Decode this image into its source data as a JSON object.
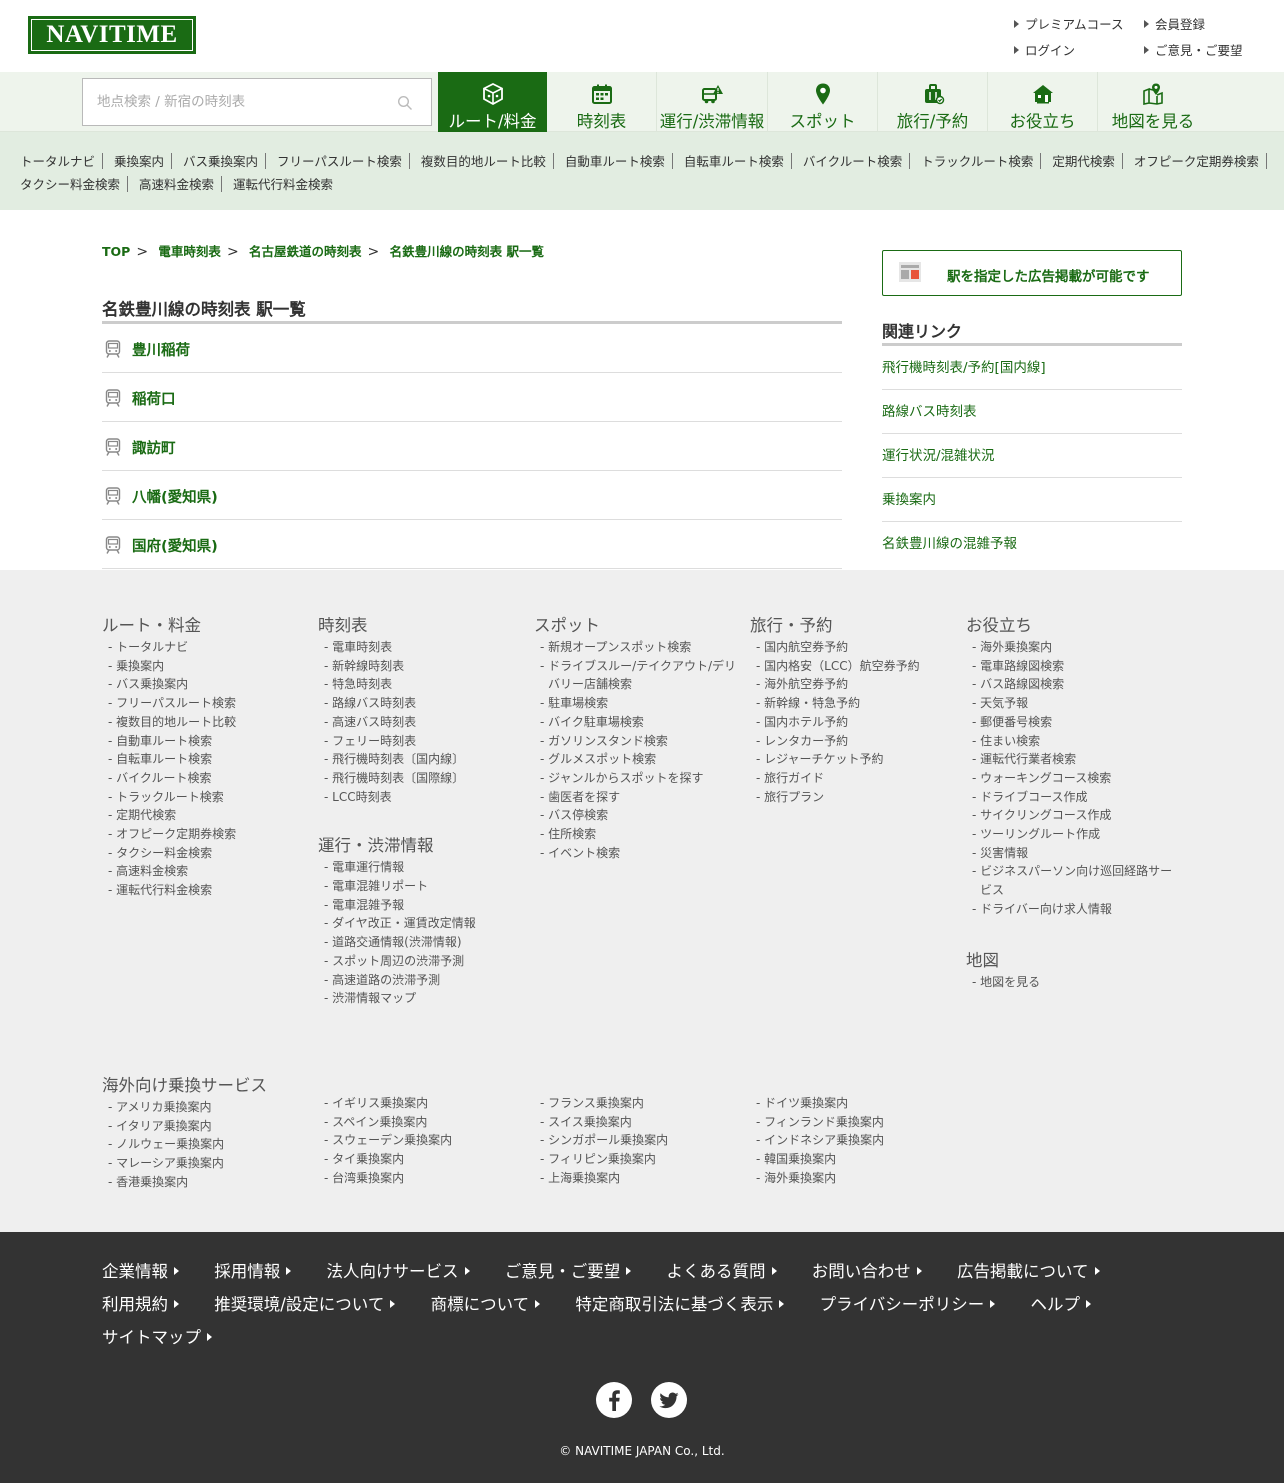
{
  "header": {
    "logo": "NAVITIME",
    "links": [
      "プレミアムコース",
      "会員登録",
      "ログイン",
      "ご意見・ご要望"
    ]
  },
  "search": {
    "placeholder": "地点検索 / 新宿の時刻表"
  },
  "nav": {
    "tabs": [
      {
        "label": "ルート/料金",
        "icon": "route-box-icon",
        "active": true
      },
      {
        "label": "時刻表",
        "icon": "calendar-icon"
      },
      {
        "label": "運行/渋滞情報",
        "icon": "traffic-info-icon"
      },
      {
        "label": "スポット",
        "icon": "map-pin-icon"
      },
      {
        "label": "旅行/予約",
        "icon": "suitcase-icon"
      },
      {
        "label": "お役立ち",
        "icon": "house-icon"
      },
      {
        "label": "地図を見る",
        "icon": "map-icon"
      }
    ]
  },
  "subnav": {
    "row1": [
      "トータルナビ",
      "乗換案内",
      "バス乗換案内",
      "フリーパスルート検索",
      "複数目的地ルート比較",
      "自動車ルート検索",
      "自転車ルート検索",
      "バイクルート検索",
      "トラックルート検索",
      "定期代検索",
      "オフピーク定期券検索"
    ],
    "row2": [
      "タクシー料金検索",
      "高速料金検索",
      "運転代行料金検索"
    ]
  },
  "breadcrumb": [
    "TOP",
    "電車時刻表",
    "名古屋鉄道の時刻表",
    "名鉄豊川線の時刻表 駅一覧"
  ],
  "breadcrumb_sep": ">",
  "main": {
    "title": "名鉄豊川線の時刻表 駅一覧",
    "stations": [
      "豊川稲荷",
      "稲荷口",
      "諏訪町",
      "八幡(愛知県)",
      "国府(愛知県)"
    ]
  },
  "sidebar": {
    "ad_text": "駅を指定した広告掲載が可能です",
    "related_title": "関連リンク",
    "related": [
      "飛行機時刻表/予約[国内線]",
      "路線バス時刻表",
      "運行状況/混雑状況",
      "乗換案内",
      "名鉄豊川線の混雑予報"
    ]
  },
  "sitemap": {
    "route": {
      "title": "ルート・料金",
      "items": [
        "トータルナビ",
        "乗換案内",
        "バス乗換案内",
        "フリーパスルート検索",
        "複数目的地ルート比較",
        "自動車ルート検索",
        "自転車ルート検索",
        "バイクルート検索",
        "トラックルート検索",
        "定期代検索",
        "オフピーク定期券検索",
        "タクシー料金検索",
        "高速料金検索",
        "運転代行料金検索"
      ]
    },
    "timetable": {
      "title": "時刻表",
      "items": [
        "電車時刻表",
        "新幹線時刻表",
        "特急時刻表",
        "路線バス時刻表",
        "高速バス時刻表",
        "フェリー時刻表",
        "飛行機時刻表〔国内線〕",
        "飛行機時刻表〔国際線〕",
        "LCC時刻表"
      ]
    },
    "traffic": {
      "title": "運行・渋滞情報",
      "items": [
        "電車運行情報",
        "電車混雑リポート",
        "電車混雑予報",
        "ダイヤ改正・運賃改定情報",
        "道路交通情報(渋滞情報)",
        "スポット周辺の渋滞予測",
        "高速道路の渋滞予測",
        "渋滞情報マップ"
      ]
    },
    "spot": {
      "title": "スポット",
      "items": [
        "新規オープンスポット検索",
        "ドライブスルー/テイクアウト/デリバリー店舗検索",
        "駐車場検索",
        "バイク駐車場検索",
        "ガソリンスタンド検索",
        "グルメスポット検索",
        "ジャンルからスポットを探す",
        "歯医者を探す",
        "バス停検索",
        "住所検索",
        "イベント検索"
      ]
    },
    "travel": {
      "title": "旅行・予約",
      "items": [
        "国内航空券予約",
        "国内格安（LCC）航空券予約",
        "海外航空券予約",
        "新幹線・特急予約",
        "国内ホテル予約",
        "レンタカー予約",
        "レジャーチケット予約",
        "旅行ガイド",
        "旅行プラン"
      ]
    },
    "useful": {
      "title": "お役立ち",
      "items": [
        "海外乗換案内",
        "電車路線図検索",
        "バス路線図検索",
        "天気予報",
        "郵便番号検索",
        "住まい検索",
        "運転代行業者検索",
        "ウォーキングコース検索",
        "ドライブコース作成",
        "サイクリングコース作成",
        "ツーリングルート作成",
        "災害情報",
        "ビジネスパーソン向け巡回経路サービス",
        "ドライバー向け求人情報"
      ]
    },
    "map": {
      "title": "地図",
      "items": [
        "地図を見る"
      ]
    },
    "overseas": {
      "title": "海外向け乗換サービス",
      "col1": [
        "アメリカ乗換案内",
        "イタリア乗換案内",
        "ノルウェー乗換案内",
        "マレーシア乗換案内",
        "香港乗換案内"
      ],
      "col2": [
        "イギリス乗換案内",
        "スペイン乗換案内",
        "スウェーデン乗換案内",
        "タイ乗換案内",
        "台湾乗換案内"
      ],
      "col3": [
        "フランス乗換案内",
        "スイス乗換案内",
        "シンガポール乗換案内",
        "フィリピン乗換案内",
        "上海乗換案内"
      ],
      "col4": [
        "ドイツ乗換案内",
        "フィンランド乗換案内",
        "インドネシア乗換案内",
        "韓国乗換案内",
        "海外乗換案内"
      ]
    }
  },
  "footer": {
    "row1": [
      "企業情報",
      "採用情報",
      "法人向けサービス",
      "ご意見・ご要望",
      "よくある質問",
      "お問い合わせ",
      "広告掲載について"
    ],
    "row2": [
      "利用規約",
      "推奨環境/設定について",
      "商標について",
      "特定商取引法に基づく表示",
      "プライバシーポリシー",
      "ヘルプ"
    ],
    "row3": [
      "サイトマップ"
    ],
    "copyright": "© NAVITIME JAPAN Co., Ltd."
  },
  "colors": {
    "brand": "#1a6b14",
    "nav_bg": "#eef4ec",
    "subnav_bg": "#e2ede1",
    "sitemap_bg": "#efefef",
    "footer_bg": "#333333"
  }
}
